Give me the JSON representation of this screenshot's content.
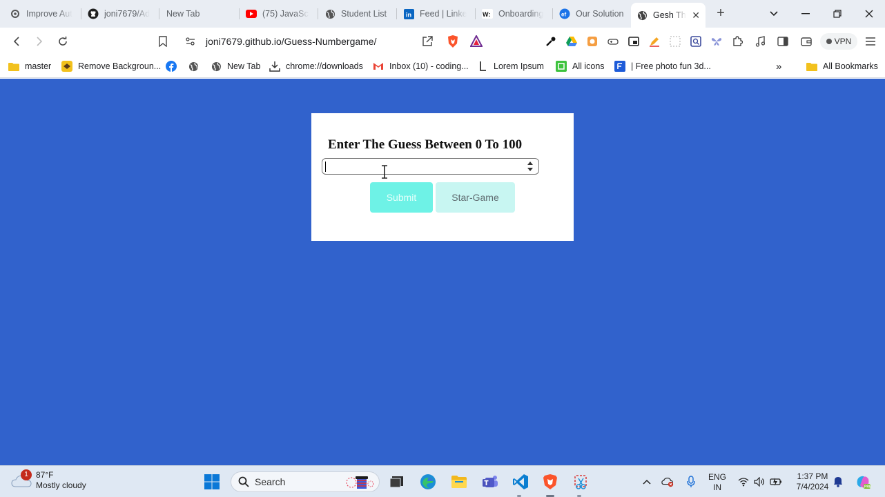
{
  "browser": {
    "tabs": [
      {
        "label": "Improve Aut",
        "icon": "gear-icon"
      },
      {
        "label": "joni7679/Ad",
        "icon": "github-icon"
      },
      {
        "label": "New Tab",
        "icon": ""
      },
      {
        "label": "(75) JavaScri",
        "icon": "youtube-icon"
      },
      {
        "label": "Student List",
        "icon": "globe-icon"
      },
      {
        "label": "Feed | Linke",
        "icon": "linkedin-icon"
      },
      {
        "label": "Onboarding",
        "icon": "wix-icon"
      },
      {
        "label": "Our Solution",
        "icon": "ef-icon"
      },
      {
        "label": "Gesh Th",
        "icon": "globe-icon",
        "active": true
      }
    ],
    "url": "joni7679.github.io/Guess-Numbergame/",
    "vpn_label": "VPN",
    "bookmarks": [
      {
        "label": "master",
        "icon": "folder-icon"
      },
      {
        "label": "Remove Backgroun...",
        "icon": "removebg-icon"
      },
      {
        "label": "",
        "icon": "facebook-icon"
      },
      {
        "label": "",
        "icon": "globe-icon"
      },
      {
        "label": "New Tab",
        "icon": "globe-icon"
      },
      {
        "label": "chrome://downloads",
        "icon": "download-icon"
      },
      {
        "label": "Inbox (10) - coding...",
        "icon": "gmail-icon"
      },
      {
        "label": "Lorem Ipsum",
        "icon": "lorem-icon"
      },
      {
        "label": "All icons",
        "icon": "all-icons-icon"
      },
      {
        "label": "| Free photo fun 3d...",
        "icon": "freepik-icon"
      }
    ],
    "all_bookmarks_label": "All Bookmarks",
    "overflow_label": "»"
  },
  "game": {
    "heading": "Enter The Guess Between 0 To 100",
    "input_value": "",
    "submit_label": "Submit",
    "start_label": "Star-Game"
  },
  "taskbar": {
    "weather_badge": "1",
    "temperature": "87°F",
    "condition": "Mostly cloudy",
    "search_label": "Search",
    "lang_line1": "ENG",
    "lang_line2": "IN",
    "time": "1:37 PM",
    "date": "7/4/2024"
  },
  "colors": {
    "page_bg": "#3162cc",
    "submit_bg": "#6ef2e6",
    "start_bg": "#c8f6f2"
  }
}
